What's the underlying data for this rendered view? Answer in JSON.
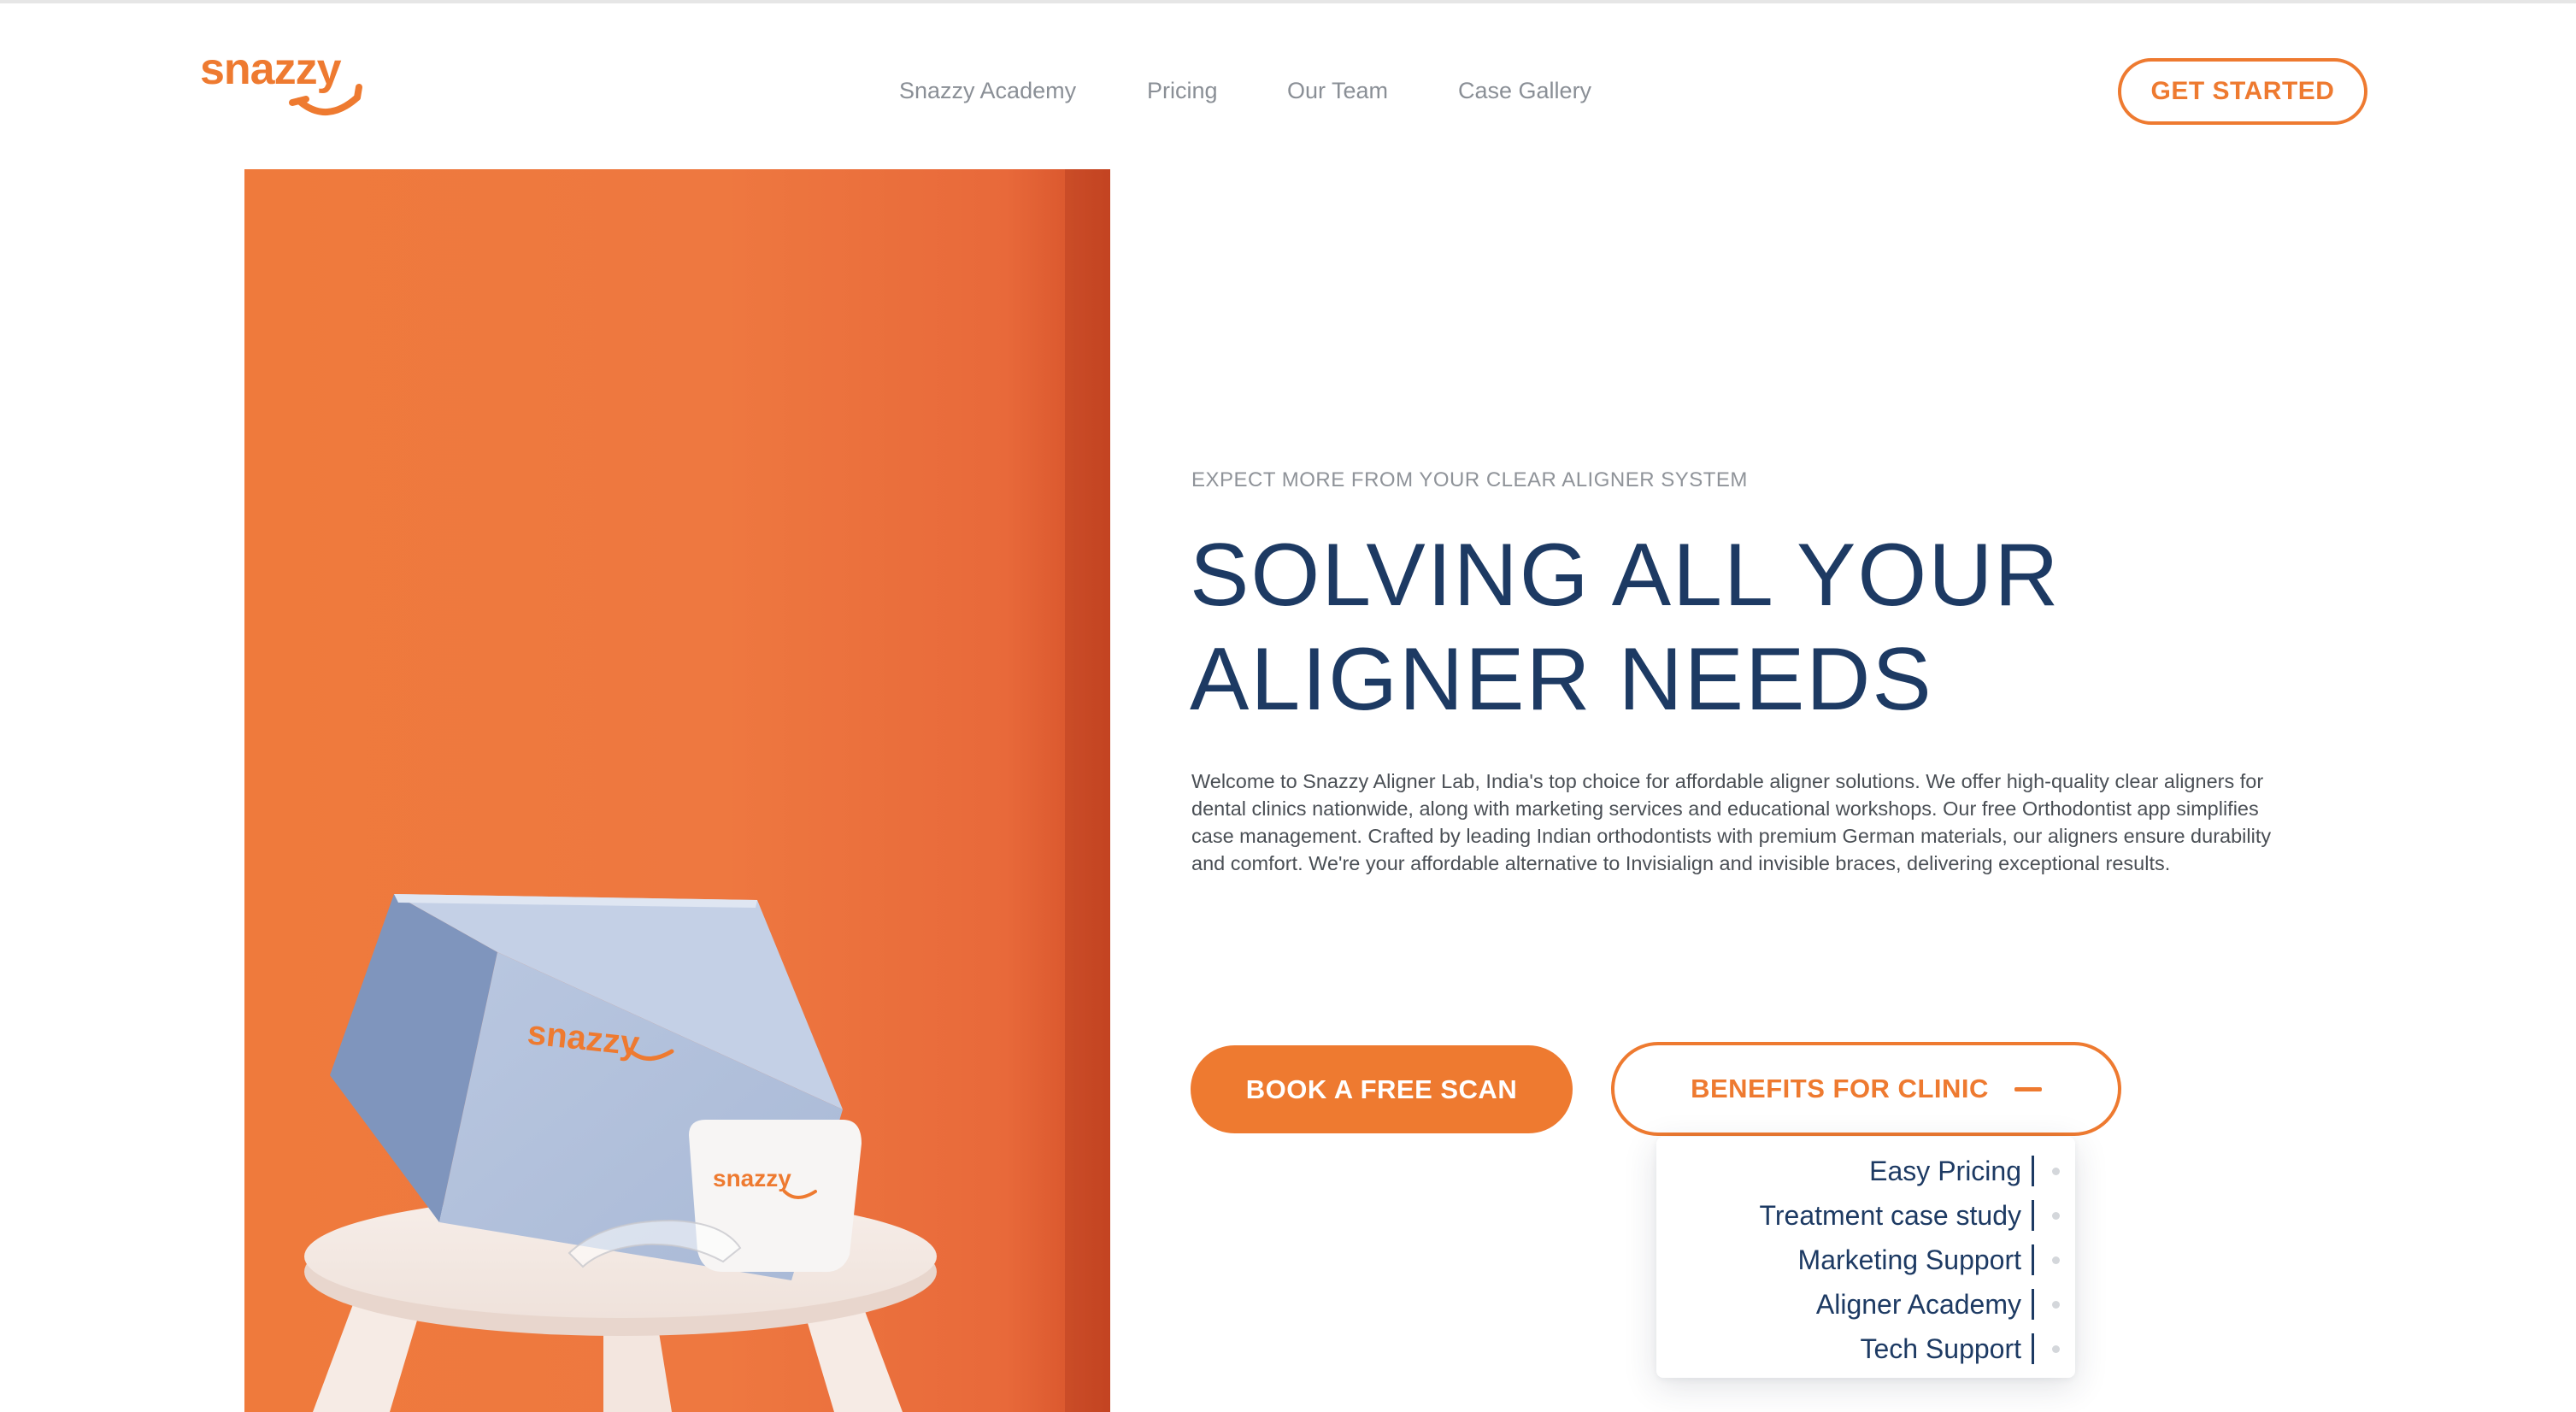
{
  "brand": {
    "logo_text": "snazzy",
    "accent_color": "#ee7a30",
    "heading_color": "#1d3a63"
  },
  "nav": {
    "items": [
      {
        "label": "Snazzy Academy"
      },
      {
        "label": "Pricing"
      },
      {
        "label": "Our Team"
      },
      {
        "label": "Case Gallery"
      }
    ],
    "cta_label": "GET STARTED"
  },
  "hero": {
    "image_box_logo": "snazzy",
    "image_case_logo": "snazzy",
    "eyebrow": "EXPECT MORE FROM YOUR CLEAR ALIGNER SYSTEM",
    "headline_line1": "SOLVING ALL YOUR",
    "headline_line2": "ALIGNER NEEDS",
    "description": "Welcome to Snazzy Aligner Lab, India's top choice for affordable aligner solutions. We offer high-quality clear aligners for dental clinics nationwide, along with marketing services and educational workshops. Our free Orthodontist app simplifies case management. Crafted by leading Indian orthodontists with premium German materials, our aligners ensure durability and comfort. We're your affordable alternative to Invisialign and invisible braces, delivering exceptional results.",
    "primary_button": "BOOK A FREE SCAN",
    "secondary_button": "BENEFITS FOR CLINIC"
  },
  "benefits_menu": {
    "items": [
      {
        "label": "Easy Pricing"
      },
      {
        "label": "Treatment case study"
      },
      {
        "label": "Marketing Support"
      },
      {
        "label": "Aligner Academy"
      },
      {
        "label": "Tech Support"
      }
    ]
  }
}
